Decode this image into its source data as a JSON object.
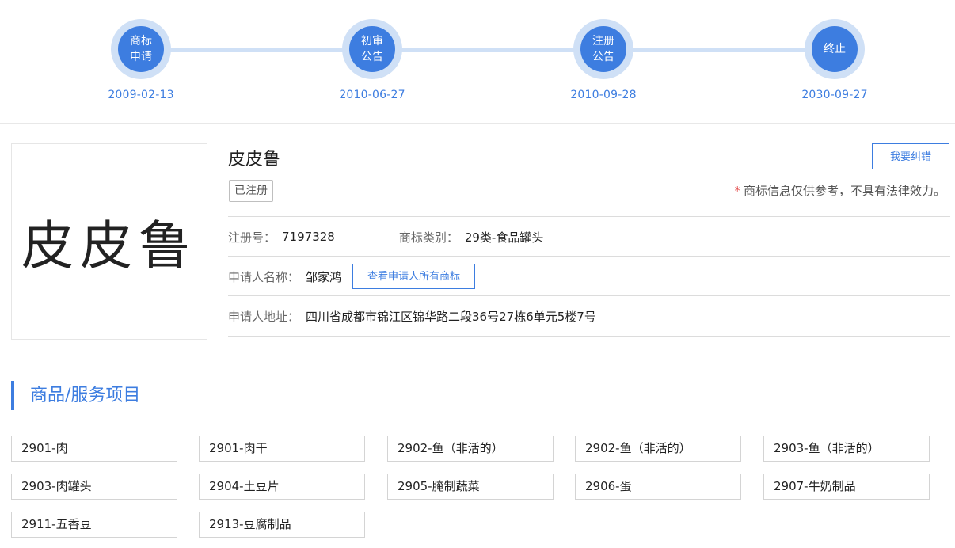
{
  "timeline": [
    {
      "label_line1": "商标",
      "label_line2": "申请",
      "date": "2009-02-13"
    },
    {
      "label_line1": "初审",
      "label_line2": "公告",
      "date": "2010-06-27"
    },
    {
      "label_line1": "注册",
      "label_line2": "公告",
      "date": "2010-09-28"
    },
    {
      "label_line1": "终止",
      "label_line2": "",
      "date": "2030-09-27"
    }
  ],
  "trademark": {
    "logo_text": "皮皮鲁",
    "name": "皮皮鲁",
    "status": "已注册",
    "report_error_label": "我要纠错",
    "notice_star": "*",
    "notice": "商标信息仅供参考，不具有法律效力。",
    "reg_no_label": "注册号：",
    "reg_no": "7197328",
    "class_label": "商标类别：",
    "class": "29类-食品罐头",
    "applicant_label": "申请人名称：",
    "applicant": "邹家鸿",
    "view_all_label": "查看申请人所有商标",
    "address_label": "申请人地址：",
    "address": "四川省成都市锦江区锦华路二段36号27栋6单元5楼7号"
  },
  "goods_section": {
    "title": "商品/服务项目",
    "items": [
      "2901-肉",
      "2901-肉干",
      "2902-鱼（非活的）",
      "2902-鱼（非活的）",
      "2903-鱼（非活的）",
      "2903-肉罐头",
      "2904-土豆片",
      "2905-腌制蔬菜",
      "2906-蛋",
      "2907-牛奶制品",
      "2911-五香豆",
      "2913-豆腐制品"
    ]
  },
  "colors": {
    "accent": "#3d7de0",
    "accent_light": "#cfe0f6",
    "required_star": "#e45353"
  }
}
